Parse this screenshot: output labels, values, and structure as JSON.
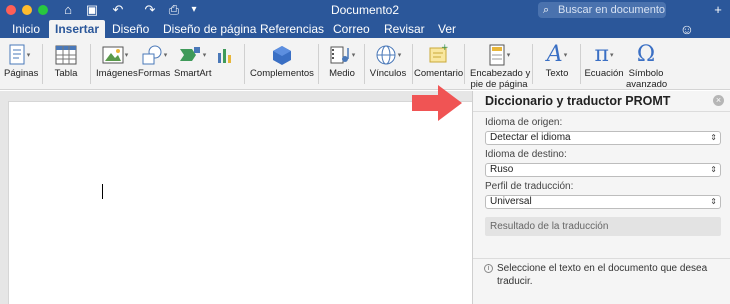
{
  "window": {
    "title": "Documento2",
    "search_placeholder": "Buscar en documento"
  },
  "tabs": [
    {
      "label": "Inicio"
    },
    {
      "label": "Insertar",
      "active": true
    },
    {
      "label": "Diseño"
    },
    {
      "label": "Diseño de página"
    },
    {
      "label": "Referencias"
    },
    {
      "label": "Correo"
    },
    {
      "label": "Revisar"
    },
    {
      "label": "Ver"
    }
  ],
  "ribbon": {
    "paginas": "Páginas",
    "tabla": "Tabla",
    "imagenes": "Imágenes",
    "formas": "Formas",
    "smartart": "SmartArt",
    "complementos": "Complementos",
    "medio": "Medio",
    "vinculos": "Vínculos",
    "comentario": "Comentario",
    "encabezado_1": "Encabezado y",
    "encabezado_2": "pie de página",
    "texto": "Texto",
    "ecuacion": "Ecuación",
    "simbolo_1": "Símbolo",
    "simbolo_2": "avanzado"
  },
  "panel": {
    "title": "Diccionario y traductor PROMT",
    "source_label": "Idioma de origen:",
    "source_value": "Detectar el idioma",
    "target_label": "Idioma de destino:",
    "target_value": "Ruso",
    "profile_label": "Perfil de traducción:",
    "profile_value": "Universal",
    "result_placeholder": "Resultado de la traducción",
    "info_text": "Seleccione el texto en el documento que desea traducir."
  },
  "colors": {
    "brand": "#2b579a",
    "arrow": "#f05454"
  },
  "icons": [
    "search-icon",
    "smiley-icon",
    "add-user-icon",
    "undo-icon",
    "redo-icon",
    "save-icon",
    "print-icon"
  ]
}
